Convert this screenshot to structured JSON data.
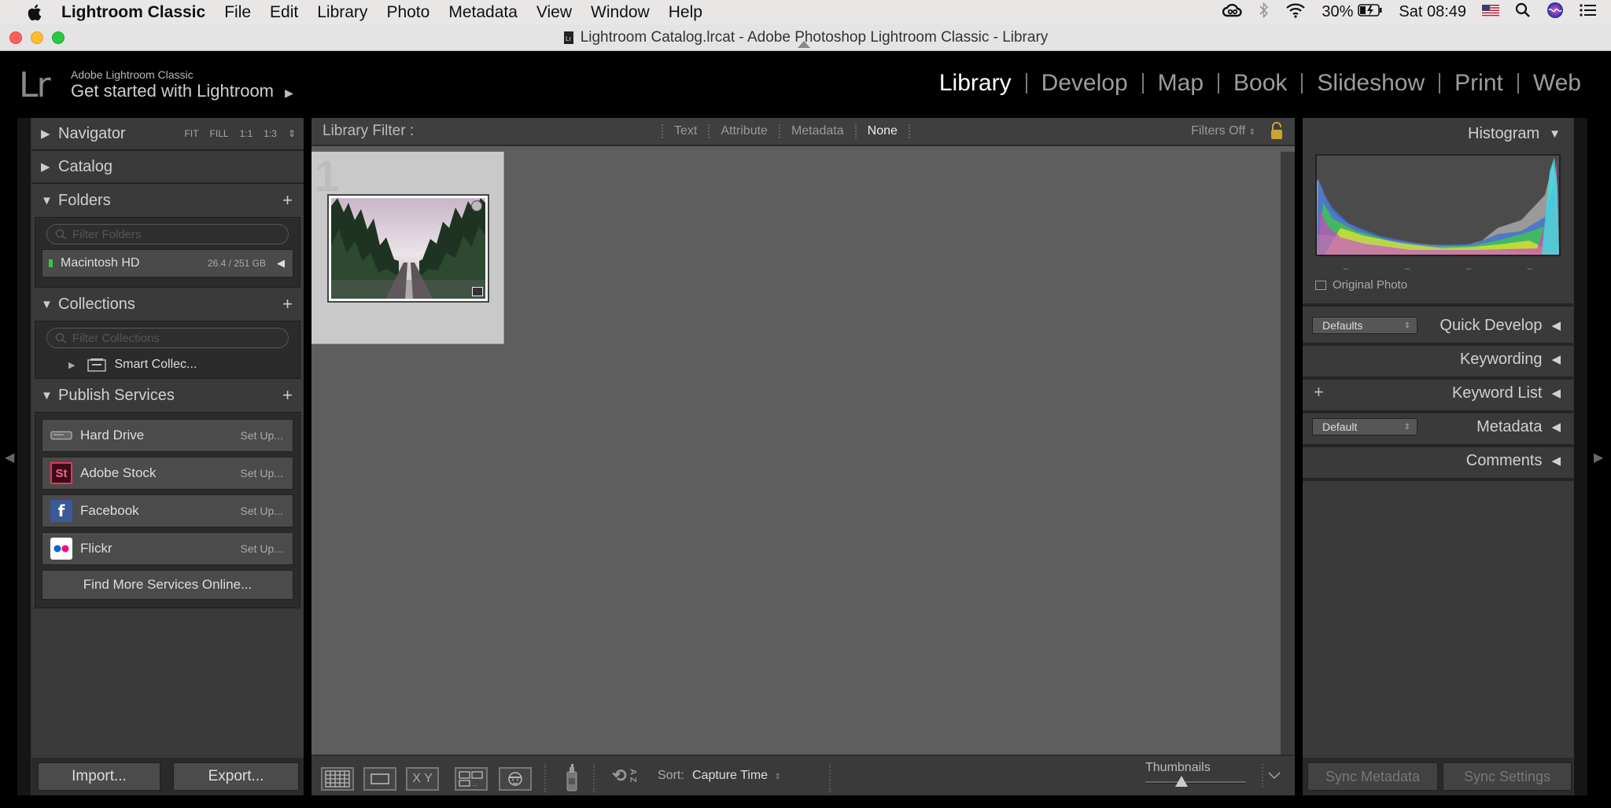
{
  "menubar": {
    "app_name": "Lightroom Classic",
    "items": [
      "File",
      "Edit",
      "Library",
      "Photo",
      "Metadata",
      "View",
      "Window",
      "Help"
    ],
    "battery": "30%",
    "clock": "Sat 08:49"
  },
  "window": {
    "title": "Lightroom Catalog.lrcat - Adobe Photoshop Lightroom Classic - Library"
  },
  "identity": {
    "logo": "Lr",
    "product": "Adobe Lightroom Classic",
    "get_started": "Get started with Lightroom",
    "get_started_arrow": "▶"
  },
  "modules": [
    {
      "label": "Library",
      "active": true
    },
    {
      "label": "Develop"
    },
    {
      "label": "Map"
    },
    {
      "label": "Book"
    },
    {
      "label": "Slideshow"
    },
    {
      "label": "Print"
    },
    {
      "label": "Web"
    }
  ],
  "left": {
    "navigator": {
      "label": "Navigator",
      "opts": [
        "FIT",
        "FILL",
        "1:1",
        "1:3"
      ]
    },
    "catalog": {
      "label": "Catalog"
    },
    "folders": {
      "label": "Folders",
      "filter_placeholder": "Filter Folders",
      "volume": {
        "name": "Macintosh HD",
        "size": "26.4 / 251 GB"
      }
    },
    "collections": {
      "label": "Collections",
      "filter_placeholder": "Filter Collections",
      "smart": "Smart Collec..."
    },
    "publish": {
      "label": "Publish Services",
      "items": [
        {
          "name": "Hard Drive",
          "setup": "Set Up..."
        },
        {
          "name": "Adobe Stock",
          "setup": "Set Up...",
          "icon_text": "St"
        },
        {
          "name": "Facebook",
          "setup": "Set Up...",
          "icon_text": "f"
        },
        {
          "name": "Flickr",
          "setup": "Set Up..."
        }
      ],
      "find_more": "Find More Services Online..."
    },
    "import": "Import...",
    "export": "Export..."
  },
  "filter": {
    "title": "Library Filter :",
    "options": [
      "Text",
      "Attribute",
      "Metadata",
      "None"
    ],
    "status": "Filters Off"
  },
  "grid": {
    "cell_number": "1"
  },
  "toolbar": {
    "sort_label": "Sort:",
    "sort_value": "Capture Time",
    "thumbnails_label": "Thumbnails",
    "compare_label": "X Y",
    "painter_label": "A Z",
    "thumbnail_size": 0.35
  },
  "right": {
    "histogram": {
      "label": "Histogram",
      "original_photo": "Original Photo"
    },
    "quick_develop": {
      "label": "Quick Develop",
      "preset": "Defaults"
    },
    "keywording": {
      "label": "Keywording"
    },
    "keyword_list": {
      "label": "Keyword List",
      "plus": "+"
    },
    "metadata": {
      "label": "Metadata",
      "preset": "Default"
    },
    "comments": {
      "label": "Comments"
    },
    "sync_metadata": "Sync Metadata",
    "sync_settings": "Sync Settings"
  }
}
